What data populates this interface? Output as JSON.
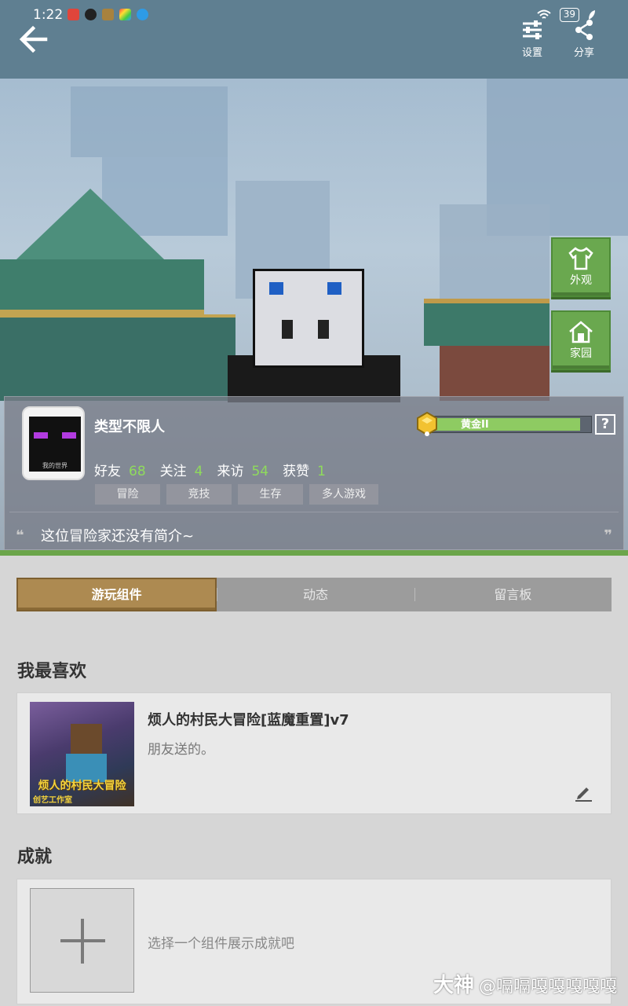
{
  "status_bar": {
    "time": "1:22",
    "battery": "39"
  },
  "header": {
    "settings_label": "设置",
    "share_label": "分享"
  },
  "side_buttons": {
    "appearance": "外观",
    "home": "家园"
  },
  "profile": {
    "nickname": "类型不限人",
    "rank": {
      "label": "黄金II",
      "progress": 1.0
    },
    "help": "?",
    "stats": [
      {
        "label": "好友",
        "value": "68"
      },
      {
        "label": "关注",
        "value": "4"
      },
      {
        "label": "来访",
        "value": "54"
      },
      {
        "label": "获赞",
        "value": "1"
      }
    ],
    "tags": [
      "冒险",
      "竞技",
      "生存",
      "多人游戏"
    ],
    "bio": "这位冒险家还没有简介~",
    "avatar_text": "我的世界"
  },
  "tabs": [
    {
      "label": "游玩组件",
      "active": true
    },
    {
      "label": "动态",
      "active": false
    },
    {
      "label": "留言板",
      "active": false
    }
  ],
  "favorites": {
    "title": "我最喜欢",
    "item": {
      "name": "烦人的村民大冒险[蓝魔重置]v7",
      "desc": "朋友送的。",
      "thumb_title": "烦人的村民大冒险",
      "thumb_studio": "创艺工作室"
    }
  },
  "achievements": {
    "title": "成就",
    "placeholder": "选择一个组件展示成就吧"
  },
  "watermark": {
    "brand": "大神",
    "user": "@嗝嗝嘎嘎嘎嘎嘎"
  },
  "colors": {
    "accent_green": "#6ba54a",
    "tab_active": "#ad8a51",
    "stat_number": "#8fdb5c"
  }
}
